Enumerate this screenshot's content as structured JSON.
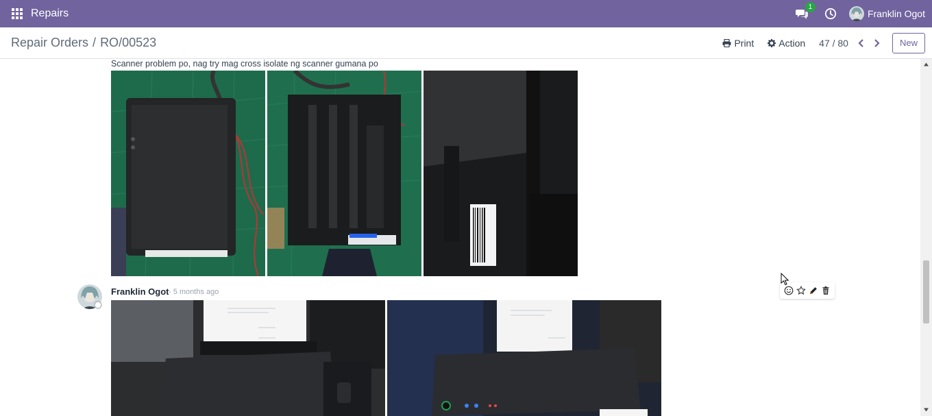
{
  "navbar": {
    "app_name": "Repairs",
    "chat_badge": "1",
    "user_name": "Franklin Ogot",
    "accent": "#71639e"
  },
  "control": {
    "breadcrumb_parent": "Repair Orders",
    "breadcrumb_separator": "/",
    "breadcrumb_current": "RO/00523",
    "print_label": "Print",
    "action_label": "Action",
    "pager": "47 / 80",
    "new_label": "New"
  },
  "chatter": {
    "messages": [
      {
        "text": "Scanner problem po, nag try mag cross isolate ng scanner gumana po",
        "attachments": [
          "photo-printer-top",
          "photo-scanner-bottom",
          "photo-barcode-label"
        ]
      },
      {
        "author": "Franklin Ogot",
        "date": "- 5 months ago",
        "attachments": [
          "photo-printer-paper-1",
          "photo-printer-paper-2"
        ]
      }
    ],
    "actions": [
      "smile-icon",
      "star-icon",
      "pencil-icon",
      "trash-icon"
    ]
  }
}
